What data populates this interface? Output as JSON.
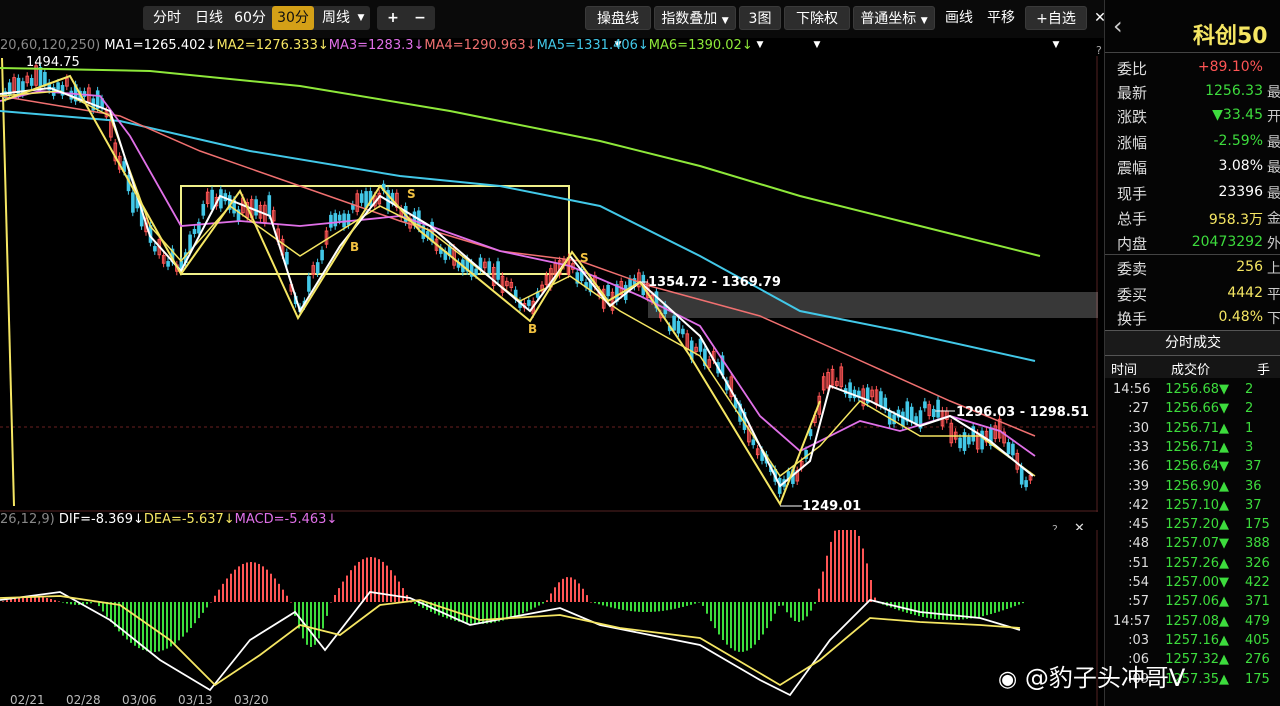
{
  "toolbar": {
    "period_buttons": [
      "分时",
      "日线",
      "60分",
      "30分",
      "周线"
    ],
    "active_period": "30分",
    "weekly_dropdown": "▼",
    "zoom_in": "+",
    "zoom_out": "−",
    "right_buttons": [
      "操盘线",
      "指数叠加",
      "3图",
      "下除权",
      "普通坐标",
      "画线",
      "平移",
      "+自选"
    ],
    "close_label": "✕"
  },
  "ma_legend": {
    "params": "20,60,120,250)",
    "ma1": "MA1=1265.402↓",
    "ma2": "MA2=1276.333↓",
    "ma3": "MA3=1283.3↓",
    "ma4": "MA4=1290.963↓",
    "ma5": "MA5=1331.406↓",
    "ma6": "MA6=1390.02↓",
    "help": "?"
  },
  "chart_annotations": {
    "high_label": "1494.75",
    "range_label_1": "1354.72 - 1369.79",
    "range_label_2": "1296.03 - 1298.51",
    "low_label": "1249.01",
    "signal": "S",
    "signal_buy": "B"
  },
  "macd_legend": {
    "params": "26,12,9)",
    "dif": "DIF=-8.369↓",
    "dea": "DEA=-5.637↓",
    "macd": "MACD=-5.463↓",
    "help": "?",
    "close": "✕"
  },
  "x_axis_dates": [
    "02/21",
    "02/28",
    "03/06",
    "03/13",
    "03/20"
  ],
  "colors": {
    "ma1": "#ffffff",
    "ma2": "#f5e663",
    "ma3": "#e070e8",
    "ma4": "#f07070",
    "ma5": "#42c8e8",
    "ma6": "#8ee83a",
    "up": "#ff5555",
    "down": "#3ddc3d",
    "box": "#f0f08a"
  },
  "quote_panel": {
    "back_icon": "‹",
    "title": "科创50",
    "rows": [
      {
        "label": "委比",
        "value": "+89.10%",
        "color": "#ff5555",
        "extra": ""
      },
      {
        "label": "最新",
        "value": "1256.33",
        "color": "#3ddc3d",
        "extra": "最"
      },
      {
        "label": "涨跌",
        "value": "▼33.45",
        "color": "#3ddc3d",
        "extra": "开"
      },
      {
        "label": "涨幅",
        "value": "-2.59%",
        "color": "#3ddc3d",
        "extra": "最"
      },
      {
        "label": "震幅",
        "value": "3.08%",
        "color": "#ffffff",
        "extra": "最"
      },
      {
        "label": "现手",
        "value": "23396",
        "color": "#ffffff",
        "extra": "最"
      },
      {
        "label": "总手",
        "value": "958.3万",
        "color": "#f5e663",
        "extra": "金"
      },
      {
        "label": "内盘",
        "value": "20473292",
        "color": "#3ddc3d",
        "extra": "外"
      },
      {
        "label": "委卖",
        "value": "256",
        "color": "#f5e663",
        "extra": "上"
      },
      {
        "label": "委买",
        "value": "4442",
        "color": "#f5e663",
        "extra": "平"
      },
      {
        "label": "换手",
        "value": "0.48%",
        "color": "#f5e663",
        "extra": "下"
      }
    ],
    "ticks_title": "分时成交",
    "ticks_header": {
      "time": "时间",
      "price": "成交价",
      "vol": "手"
    },
    "ticks": [
      {
        "time": "14:56",
        "price": "1256.68▼",
        "vol": "2"
      },
      {
        "time": ":27",
        "price": "1256.66▼",
        "vol": "2"
      },
      {
        "time": ":30",
        "price": "1256.71▲",
        "vol": "1"
      },
      {
        "time": ":33",
        "price": "1256.71▲",
        "vol": "3"
      },
      {
        "time": ":36",
        "price": "1256.64▼",
        "vol": "37"
      },
      {
        "time": ":39",
        "price": "1256.90▲",
        "vol": "36"
      },
      {
        "time": ":42",
        "price": "1257.10▲",
        "vol": "37"
      },
      {
        "time": ":45",
        "price": "1257.20▲",
        "vol": "175"
      },
      {
        "time": ":48",
        "price": "1257.07▼",
        "vol": "388"
      },
      {
        "time": ":51",
        "price": "1257.26▲",
        "vol": "326"
      },
      {
        "time": ":54",
        "price": "1257.00▼",
        "vol": "422"
      },
      {
        "time": ":57",
        "price": "1257.06▲",
        "vol": "371"
      },
      {
        "time": "14:57",
        "price": "1257.08▲",
        "vol": "479"
      },
      {
        "time": ":03",
        "price": "1257.16▲",
        "vol": "405"
      },
      {
        "time": ":06",
        "price": "1257.32▲",
        "vol": "276"
      },
      {
        "time": ":09",
        "price": "1257.35▲",
        "vol": "175"
      }
    ]
  },
  "watermark": "@豹子头冲哥V"
}
